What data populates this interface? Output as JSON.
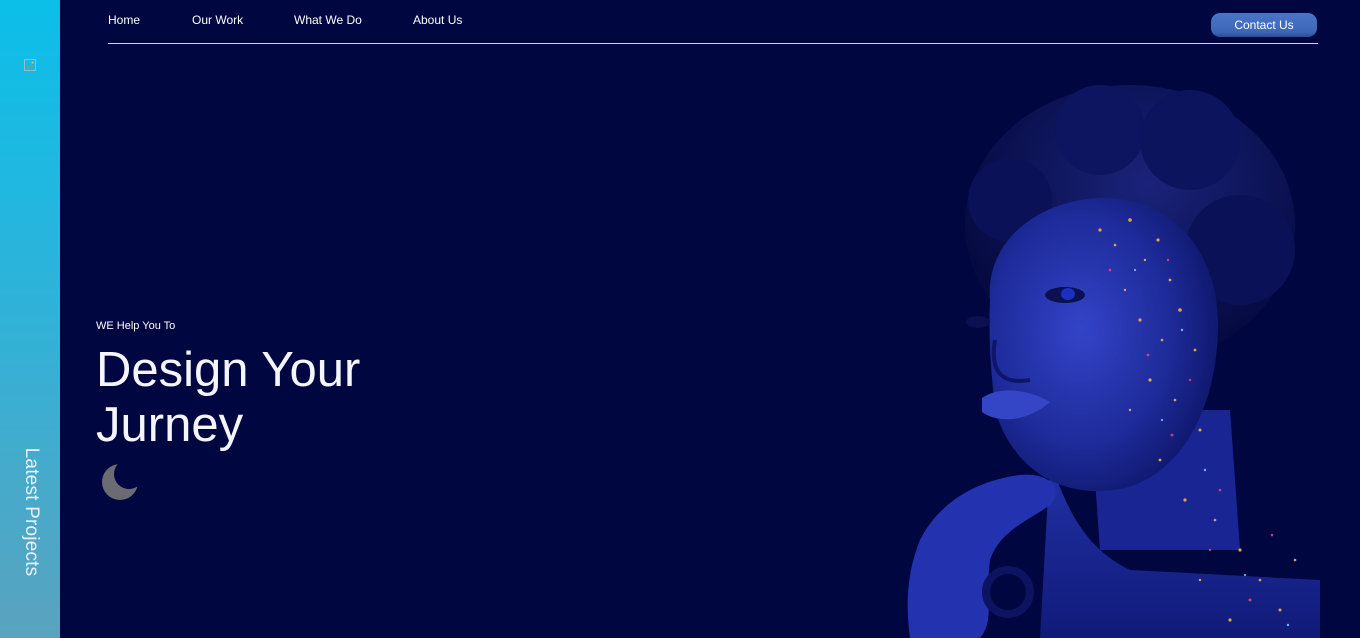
{
  "sidebar": {
    "label": "Latest Projects",
    "logo_icon": "broken-image-icon"
  },
  "nav": {
    "items": [
      {
        "label": "Home"
      },
      {
        "label": "Our Work"
      },
      {
        "label": "What We Do"
      },
      {
        "label": "About Us"
      }
    ],
    "contact_label": "Contact Us"
  },
  "hero": {
    "eyebrow": "WE Help You To",
    "title_line1": "Design Your",
    "title_line2": "Jurney",
    "theme_icon": "moon-icon"
  },
  "colors": {
    "background": "#000640",
    "sidebar_top": "#0bbfe9",
    "sidebar_bottom": "#5aa3bf",
    "accent_button": "#3d66b7",
    "portrait_tint": "#1c2a9e"
  }
}
